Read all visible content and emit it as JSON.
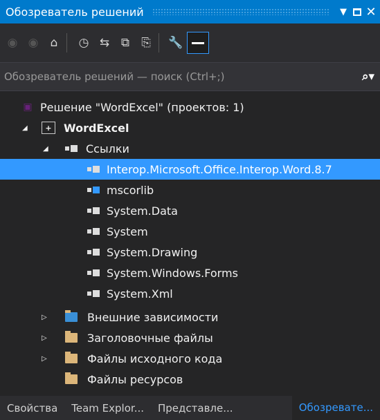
{
  "window": {
    "title": "Обозреватель решений",
    "colors": {
      "accent": "#007acc",
      "selection": "#3399ff",
      "background": "#252526"
    }
  },
  "search": {
    "placeholder": "Обозреватель решений — поиск (Ctrl+;)"
  },
  "tree": {
    "solution": "Решение \"WordExcel\"  (проектов: 1)",
    "project": "WordExcel",
    "references": "Ссылки",
    "refs": [
      "Interop.Microsoft.Office.Interop.Word.8.7",
      "mscorlib",
      "System.Data",
      "System",
      "System.Drawing",
      "System.Windows.Forms",
      "System.Xml"
    ],
    "external": "Внешние зависимости",
    "headers": "Заголовочные файлы",
    "sources": "Файлы исходного кода",
    "resources": "Файлы ресурсов"
  },
  "bottom_tabs": {
    "properties": "Свойства",
    "team": "Team Explor...",
    "class_view": "Представле...",
    "solution_explorer": "Обозревате..."
  }
}
